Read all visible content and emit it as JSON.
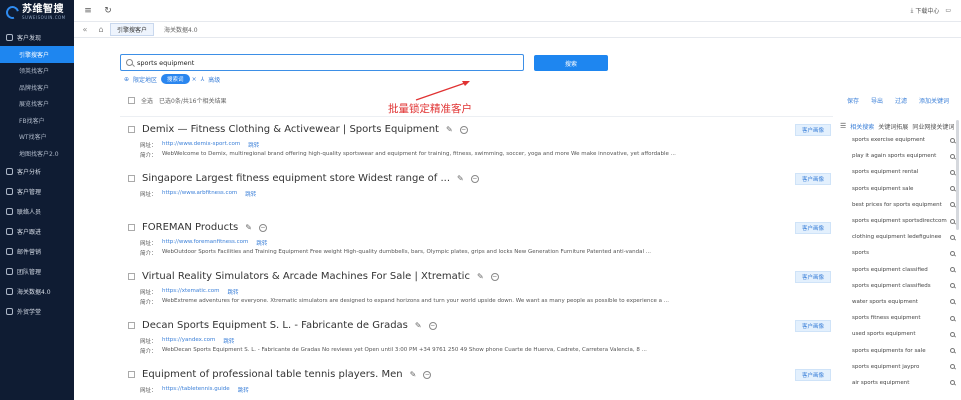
{
  "logo": {
    "cn": "苏维智搜",
    "en": "SUWEISOUIN.COM"
  },
  "sidebar": {
    "groups": [
      {
        "label": "客户发现",
        "subs": [
          "引擎搜客户",
          "领英找客户",
          "品牌找客户",
          "展览找客户",
          "FB找客户",
          "WT找客户",
          "地图找客户2.0"
        ]
      },
      {
        "label": "客户分析"
      },
      {
        "label": "客户管理"
      },
      {
        "label": "联络人员"
      },
      {
        "label": "客户跟进"
      },
      {
        "label": "邮件营销"
      },
      {
        "label": "团队管理"
      },
      {
        "label": "海关数据4.0"
      },
      {
        "label": "外贸学堂"
      }
    ]
  },
  "topbar": {
    "menu_icon": "≡",
    "refresh_icon": "↻",
    "download_label": "下载中心",
    "window_icon": "▭"
  },
  "tabs": [
    {
      "label": "引擎搜客户"
    },
    {
      "label": "海关数据4.0"
    }
  ],
  "search": {
    "value": "sports equipment",
    "button_label": "搜索"
  },
  "options": {
    "opt1": "限定地区",
    "pill": "搜索词",
    "pill_close": "×",
    "opt2": "高级"
  },
  "annotation": "批量锁定精准客户",
  "list_head": {
    "select_all": "全选",
    "summary": "已选0条/共16个相关结果",
    "actions": [
      "保存",
      "导出",
      "过滤",
      "添加关键词"
    ]
  },
  "results": [
    {
      "title": "Demix — Fitness Clothing & Activewear | Sports Equipment",
      "site_label": "网址：",
      "url": "http://www.demix-sport.com",
      "jump": "跳转",
      "desc_label": "简介：",
      "desc": "WebWelcome to Demix, multiregional brand offering high-quality sportswear and equipment for training, fitness, swimming, soccer, yoga and more We make innovative, yet affordable ...",
      "btn": "客户画像"
    },
    {
      "title": "Singapore Largest fitness equipment store Widest range of ...",
      "site_label": "网址：",
      "url": "https://www.arbfitness.com",
      "jump": "跳转",
      "desc_label": "简介：",
      "desc": "",
      "btn": "客户画像"
    },
    {
      "title": "FOREMAN Products",
      "site_label": "网址：",
      "url": "http://www.foremanfitness.com",
      "jump": "跳转",
      "desc_label": "简介：",
      "desc": "WebOutdoor Sports Facilities and Training Equipment Free weight High-quality dumbbells, bars, Olympic plates, grips and locks New Generation Furniture Patented anti-vandal ...",
      "btn": "客户画像"
    },
    {
      "title": "Virtual Reality Simulators & Arcade Machines For Sale | Xtrematic",
      "site_label": "网址：",
      "url": "https://xtematic.com",
      "jump": "跳转",
      "desc_label": "简介：",
      "desc": "WebExtreme adventures for everyone. Xtrematic simulators are designed to expand horizons and turn your world upside down. We want as many people as possible to experience a ...",
      "btn": "客户画像"
    },
    {
      "title": "Decan Sports Equipment S. L. - Fabricante de Gradas",
      "site_label": "网址：",
      "url": "https://yandex.com",
      "jump": "跳转",
      "desc_label": "简介：",
      "desc": "WebDecan Sports Equipment S. L. - Fabricante de Gradas No reviews yet Open until 3:00 PM +34 9761 250 49 Show phone Cuarte de Huerva, Cadrete, Carretera Valencia, 8 ...",
      "btn": "客户画像"
    },
    {
      "title": "Equipment of professional table tennis players. Men",
      "site_label": "网址：",
      "url": "https://tabletennis.guide",
      "jump": "跳转",
      "desc_label": "",
      "desc": "",
      "btn": "客户画像"
    }
  ],
  "right_panel": {
    "tabs": [
      "相关搜索",
      "关键词拓展",
      "同业网搜关键词"
    ],
    "keywords": [
      "sports exercise equipment",
      "play it again sports equipment",
      "sports equipment rental",
      "sports equipment sale",
      "best prices for sports equipment",
      "sports equipment sportsdirectcom",
      "clothing equipment ledefiguinee",
      "sports",
      "sports equipment classified",
      "sports equipment classifieds",
      "water sports equipment",
      "sports fitness equipment",
      "used sports equipment",
      "sports equipments for sale",
      "sports equipment jaypro",
      "air sports equipment"
    ]
  }
}
